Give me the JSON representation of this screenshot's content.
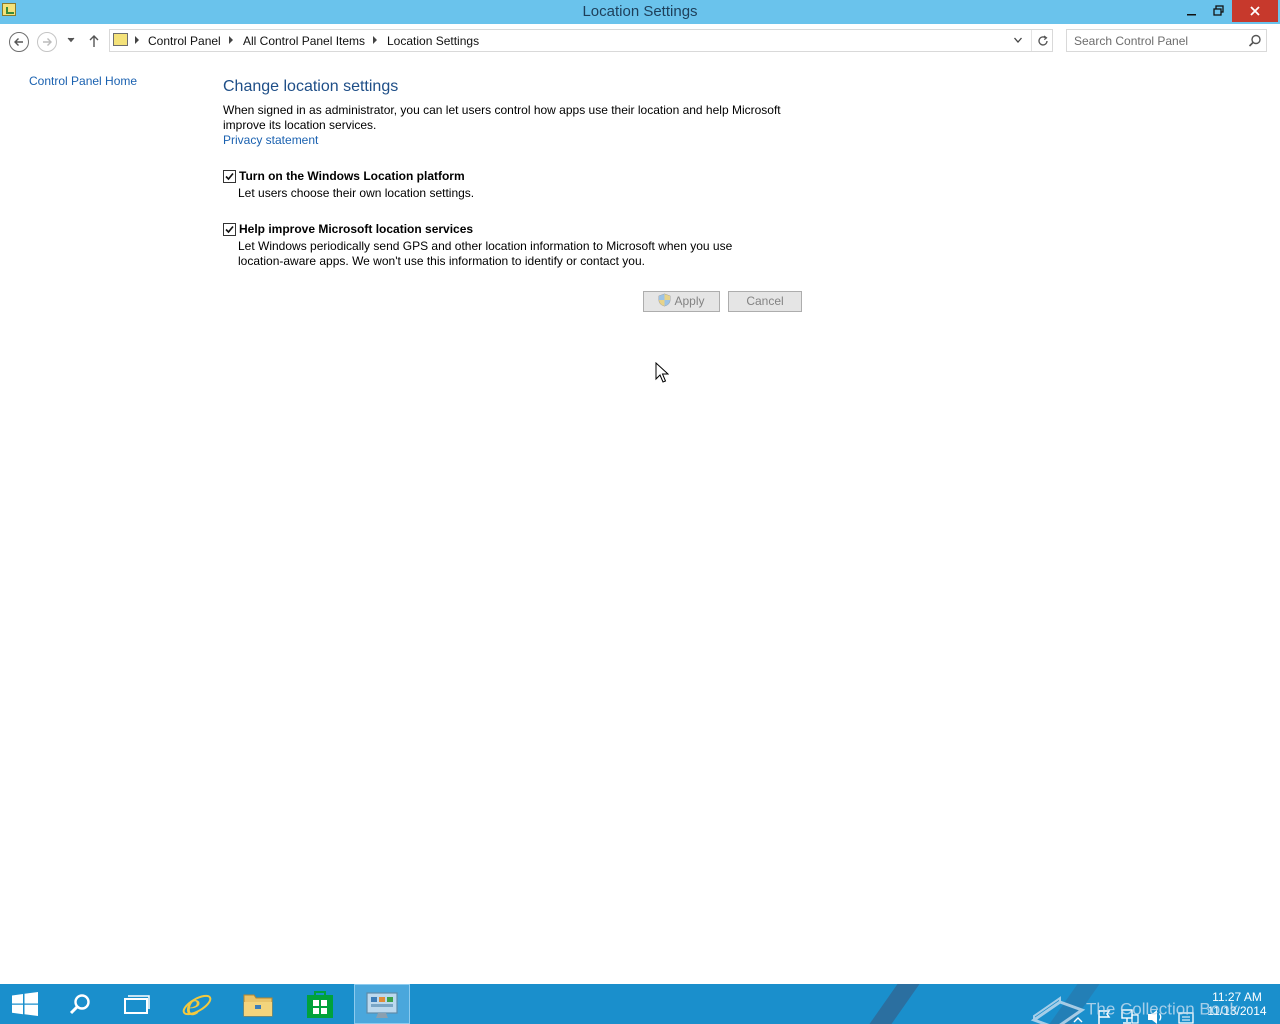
{
  "window": {
    "title": "Location Settings",
    "minimize": "–",
    "restore": "❐",
    "close": "✕"
  },
  "nav": {
    "breadcrumb": [
      "Control Panel",
      "All Control Panel Items",
      "Location Settings"
    ],
    "search_placeholder": "Search Control Panel"
  },
  "sidebar": {
    "home_link": "Control Panel Home"
  },
  "main": {
    "heading": "Change location settings",
    "description": "When signed in as administrator, you can let users control how apps use their location and help Microsoft improve its location services.",
    "privacy_link": "Privacy statement",
    "options": [
      {
        "label": "Turn on the Windows Location platform",
        "description": "Let users choose their own location settings.",
        "checked": true
      },
      {
        "label": "Help improve Microsoft location services",
        "description": "Let Windows periodically send GPS and other location information to Microsoft when you use location-aware apps. We won't use this information to identify or contact you.",
        "checked": true
      }
    ],
    "apply_label": "Apply",
    "cancel_label": "Cancel"
  },
  "taskbar": {
    "clock_time": "11:27 AM",
    "clock_date": "11/13/2014",
    "watermark": "The Collection Book",
    "pinned": [
      "start-icon",
      "search-icon",
      "task-view-icon",
      "internet-explorer-icon",
      "file-explorer-icon",
      "store-icon",
      "control-panel-icon"
    ]
  },
  "colors": {
    "titlebar": "#6ac3ec",
    "taskbar": "#1a8fcc",
    "link": "#1a61b0",
    "heading": "#1e4e87",
    "close_button": "#c7392c"
  }
}
